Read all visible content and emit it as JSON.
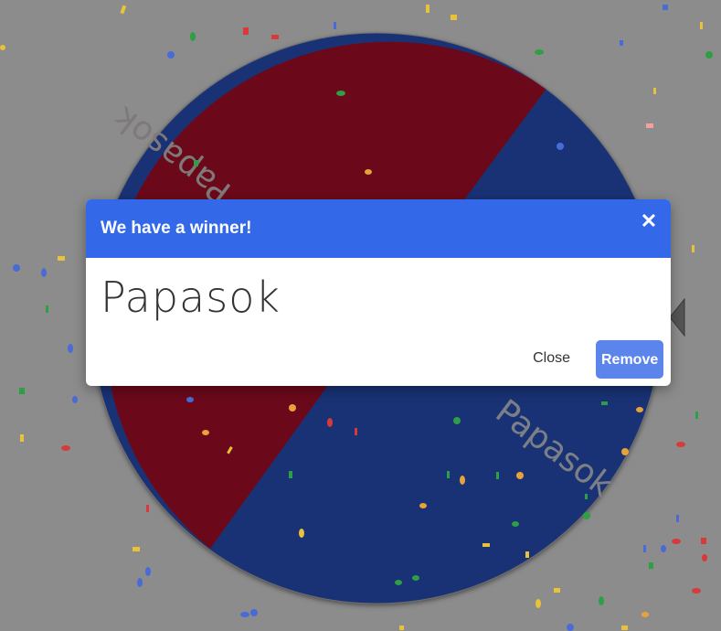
{
  "wheel": {
    "segments": [
      {
        "label": "Papasok",
        "color": "#c41230"
      },
      {
        "label": "Papasok",
        "color": "#2e5cd6"
      }
    ]
  },
  "dialog": {
    "title": "We have a winner!",
    "winner": "Papasok",
    "close_label": "Close",
    "remove_label": "Remove",
    "header_color": "#3369e8"
  }
}
